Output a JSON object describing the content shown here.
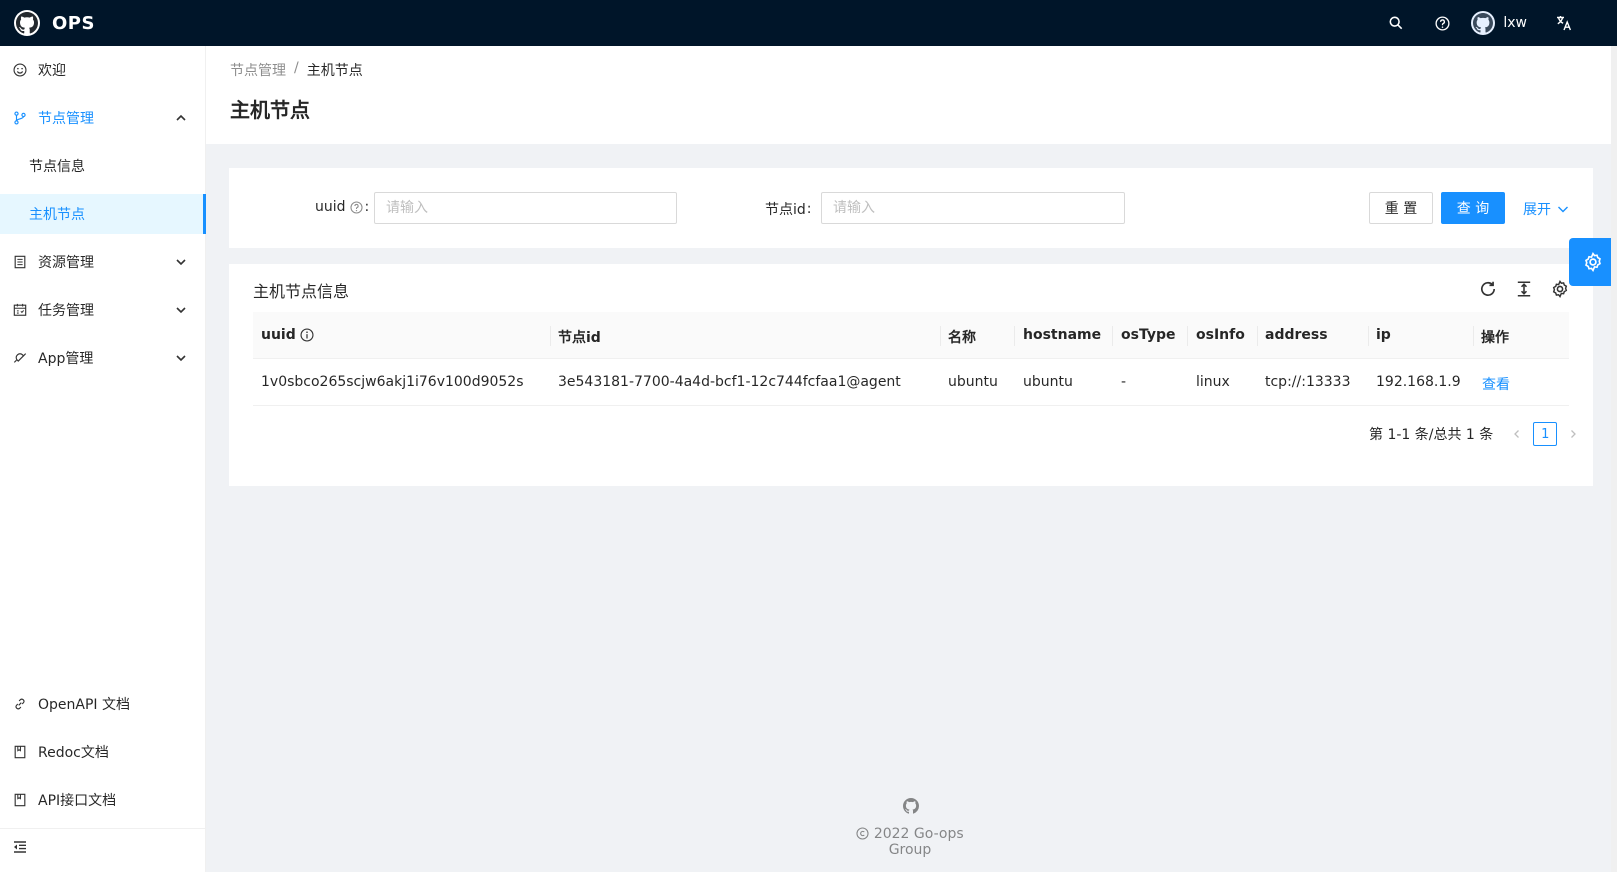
{
  "app": {
    "title": "OPS",
    "user_name": "lxw"
  },
  "sidebar": {
    "items": [
      {
        "label": "欢迎",
        "icon": "smile-icon"
      },
      {
        "label": "节点管理",
        "icon": "branches-icon",
        "expanded": true
      },
      {
        "label": "节点信息"
      },
      {
        "label": "主机节点",
        "selected": true
      },
      {
        "label": "资源管理",
        "icon": "profile-icon"
      },
      {
        "label": "任务管理",
        "icon": "schedule-icon"
      },
      {
        "label": "App管理",
        "icon": "api-icon"
      }
    ],
    "bottom_links": [
      {
        "label": "OpenAPI 文档",
        "icon": "link-icon"
      },
      {
        "label": "Redoc文档",
        "icon": "book-icon"
      },
      {
        "label": "API接口文档",
        "icon": "book-icon"
      }
    ]
  },
  "breadcrumb": {
    "parent": "节点管理",
    "separator": "/",
    "current": "主机节点"
  },
  "page": {
    "title": "主机节点"
  },
  "search": {
    "uuid_label": "uuid",
    "uuid_colon": ":",
    "uuid_placeholder": "请输入",
    "nodeid_label": "节点id",
    "nodeid_colon": ":",
    "nodeid_placeholder": "请输入",
    "reset_label": "重 置",
    "query_label": "查 询",
    "expand_label": "展开"
  },
  "table": {
    "title": "主机节点信息",
    "columns": [
      "uuid",
      "节点id",
      "名称",
      "hostname",
      "osType",
      "osInfo",
      "address",
      "ip",
      "操作"
    ],
    "rows": [
      {
        "uuid": "1v0sbco265scjw6akj1i76v100d9052s",
        "node_id": "3e543181-7700-4a4d-bcf1-12c744fcfaa1@agent",
        "name": "ubuntu",
        "hostname": "ubuntu",
        "os_type": "-",
        "os_info": "linux",
        "address": "tcp://:13333",
        "ip": "192.168.1.9",
        "action": "查看"
      }
    ]
  },
  "pagination": {
    "total_text": "第 1-1 条/总共 1 条",
    "current_page": "1"
  },
  "footer": {
    "copyright": "2022 Go-ops Group"
  },
  "colors": {
    "header_bg": "#001529",
    "primary": "#1890ff",
    "page_bg": "#f0f2f5"
  }
}
